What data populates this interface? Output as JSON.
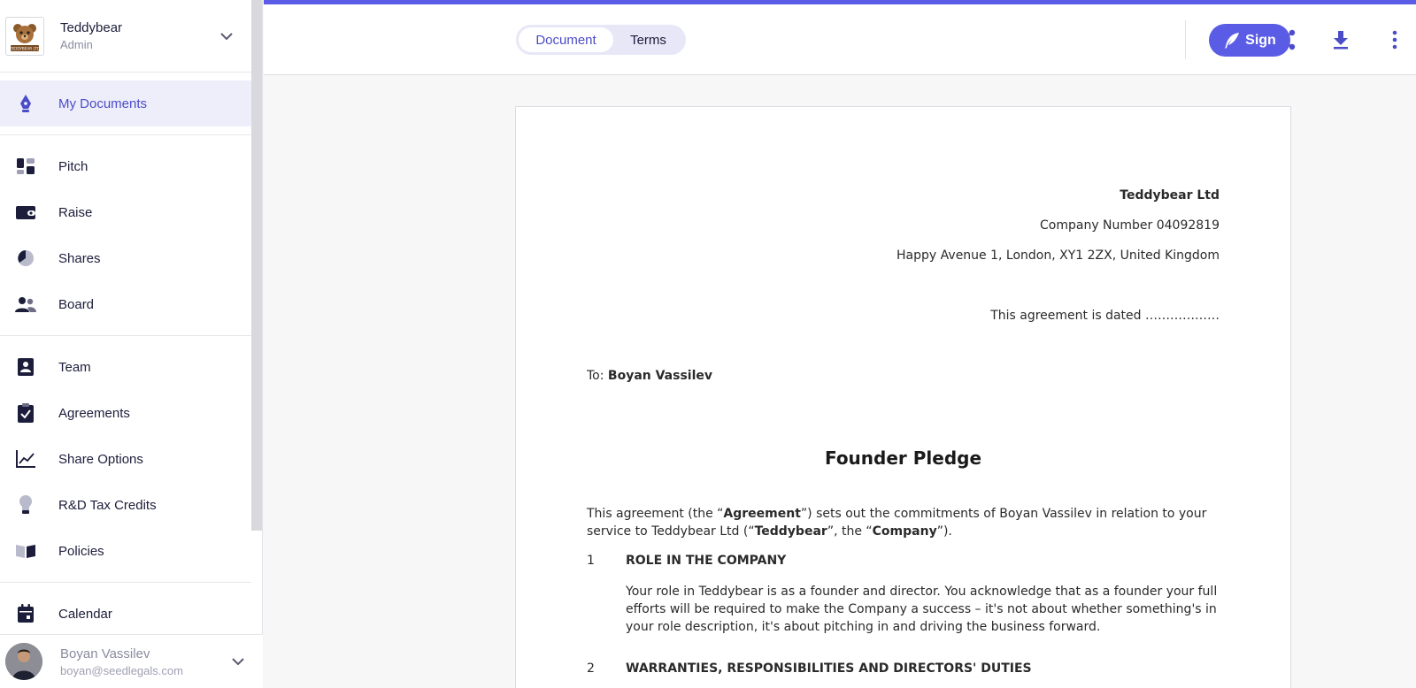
{
  "sidebar": {
    "org": {
      "name": "Teddybear",
      "role": "Admin",
      "logo_text": "TEDDYBEAR LTD"
    },
    "groups": [
      [
        {
          "label": "My Documents",
          "icon": "pen-nib-icon",
          "active": true
        }
      ],
      [
        {
          "label": "Pitch",
          "icon": "dashboard-icon"
        },
        {
          "label": "Raise",
          "icon": "wallet-icon"
        },
        {
          "label": "Shares",
          "icon": "pie-chart-icon"
        },
        {
          "label": "Board",
          "icon": "people-icon"
        }
      ],
      [
        {
          "label": "Team",
          "icon": "id-badge-icon"
        },
        {
          "label": "Agreements",
          "icon": "clipboard-check-icon"
        },
        {
          "label": "Share Options",
          "icon": "line-chart-icon"
        },
        {
          "label": "R&D Tax Credits",
          "icon": "lightbulb-icon"
        },
        {
          "label": "Policies",
          "icon": "book-icon"
        }
      ],
      [
        {
          "label": "Calendar",
          "icon": "calendar-icon"
        }
      ]
    ],
    "user": {
      "name": "Boyan Vassilev",
      "email": "boyan@seedlegals.com"
    }
  },
  "topbar": {
    "tabs": {
      "document": "Document",
      "terms": "Terms"
    },
    "tools": [
      "signature-icon",
      "share-icon",
      "download-icon",
      "more-vertical-icon"
    ],
    "sign_label": "Sign",
    "accent_color": "#5b5ce6"
  },
  "document": {
    "company_name": "Teddybear Ltd",
    "company_number": "Company Number 04092819",
    "address": "Happy Avenue 1, London, XY1 2ZX, United Kingdom",
    "dated": "This agreement is dated ………………",
    "to_prefix": "To: ",
    "to_name": "Boyan Vassilev",
    "title": "Founder Pledge",
    "intro": {
      "p1": "This agreement (the “",
      "b1": "Agreement",
      "p2": "”) sets out the commitments of Boyan Vassilev in relation to your service to Teddybear Ltd (“",
      "b2": "Teddybear",
      "p3": "”, the “",
      "b3": "Company",
      "p4": "”)."
    },
    "clauses": [
      {
        "number": "1",
        "heading": "ROLE IN THE COMPANY",
        "body": "Your role in Teddybear is as a founder and director. You acknowledge that as a founder your full efforts will be required to make the Company a success – it's not about whether something's in your role description, it's about pitching in and driving the business forward."
      },
      {
        "number": "2",
        "heading": "WARRANTIES, RESPONSIBILITIES AND DIRECTORS' DUTIES",
        "body": ""
      }
    ]
  }
}
